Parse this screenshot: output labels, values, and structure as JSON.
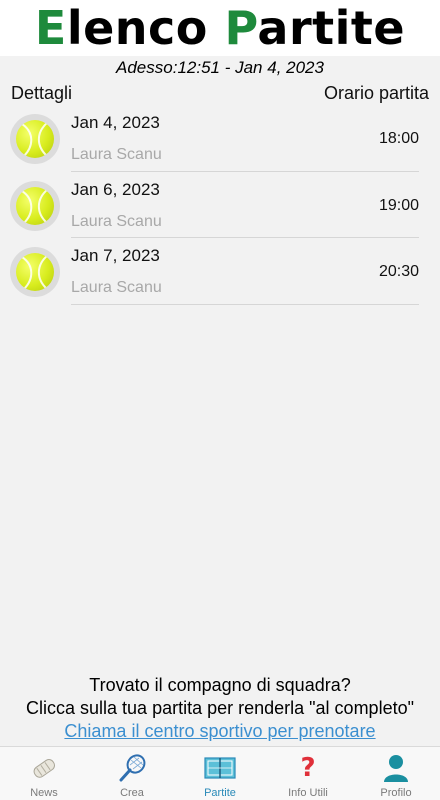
{
  "header": {
    "title_first_letter": "E",
    "title_rest_1": "lenco ",
    "title_second_letter": "P",
    "title_rest_2": "artite",
    "accent_color": "#1e8a3c"
  },
  "now": {
    "label": "Adesso:",
    "value": "12:51 - Jan 4, 2023"
  },
  "columns": {
    "left": "Dettagli",
    "right": "Orario partita"
  },
  "matches": [
    {
      "date": "Jan 4, 2023",
      "player": "Laura Scanu",
      "time": "18:00"
    },
    {
      "date": "Jan 6, 2023",
      "player": "Laura Scanu",
      "time": "19:00"
    },
    {
      "date": "Jan 7, 2023",
      "player": "Laura Scanu",
      "time": "20:30"
    }
  ],
  "info": {
    "line1": "Trovato il compagno di squadra?",
    "line2": "Clicca sulla tua partita per renderla \"al completo\"",
    "link": "Chiama il centro sportivo per prenotare",
    "link_color": "#3b8fd0"
  },
  "tabs": [
    {
      "label": "News",
      "icon": "newspaper-icon"
    },
    {
      "label": "Crea",
      "icon": "tennis-racket-icon"
    },
    {
      "label": "Partite",
      "icon": "tennis-court-icon",
      "active": true
    },
    {
      "label": "Info Utili",
      "icon": "question-mark-icon"
    },
    {
      "label": "Profilo",
      "icon": "user-icon"
    }
  ],
  "active_tab_color": "#2a8ab8"
}
